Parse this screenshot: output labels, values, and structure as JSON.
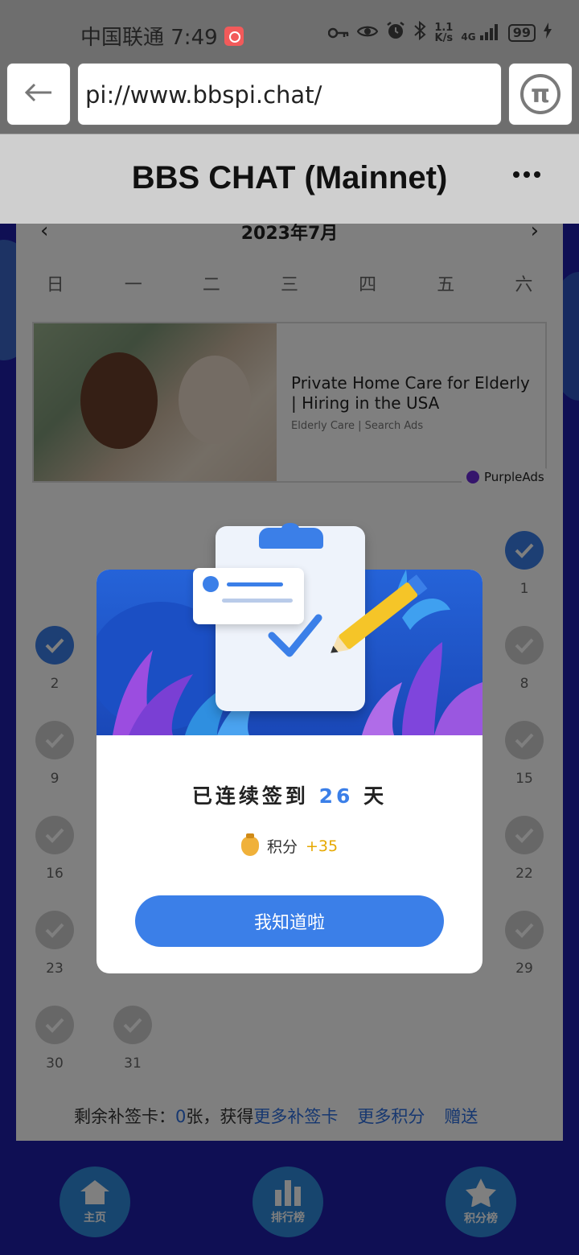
{
  "status_bar": {
    "carrier_time": "中国联通 7:49",
    "speed_value": "1.1",
    "speed_unit": "K/s",
    "signal": "4G",
    "battery": "99"
  },
  "browser": {
    "url": "pi://www.bbspi.chat/",
    "pi_icon": "π"
  },
  "header": {
    "title": "BBS CHAT (Mainnet)"
  },
  "calendar": {
    "prev": "‹",
    "next": "›",
    "month": "2023年7月",
    "weekdays": [
      "日",
      "一",
      "二",
      "三",
      "四",
      "五",
      "六"
    ],
    "days_visible": [
      {
        "label": "1",
        "checked": true
      },
      {
        "label": "2",
        "checked": true
      },
      {
        "label": "8",
        "checked": false
      },
      {
        "label": "9",
        "checked": false
      },
      {
        "label": "15",
        "checked": false
      },
      {
        "label": "16",
        "checked": false
      },
      {
        "label": "22",
        "checked": false
      },
      {
        "label": "23",
        "checked": false
      },
      {
        "label": "29",
        "checked": false
      },
      {
        "label": "30",
        "checked": false
      },
      {
        "label": "31",
        "checked": false
      }
    ]
  },
  "ad": {
    "title": "Private Home Care for Elderly | Hiring in the USA",
    "subtitle": "Elderly Care | Search Ads",
    "brand": "PurpleAds"
  },
  "footer": {
    "remaining_label": "剩余补签卡：",
    "remaining_count": "0",
    "remaining_unit": "张，获得",
    "more_cards": "更多补签卡",
    "more_points": "更多积分",
    "gift": "赠送"
  },
  "bottom_nav": {
    "home": "主页",
    "ranking": "排行榜",
    "points_ranking": "积分榜"
  },
  "modal": {
    "title_prefix": "已连续签到",
    "streak": "26",
    "title_suffix": "天",
    "points_label": "积分",
    "points_value": "+35",
    "button": "我知道啦"
  },
  "colors": {
    "accent": "#3b7fe8",
    "page_bg": "#1e1ea8",
    "points": "#e6a800"
  }
}
